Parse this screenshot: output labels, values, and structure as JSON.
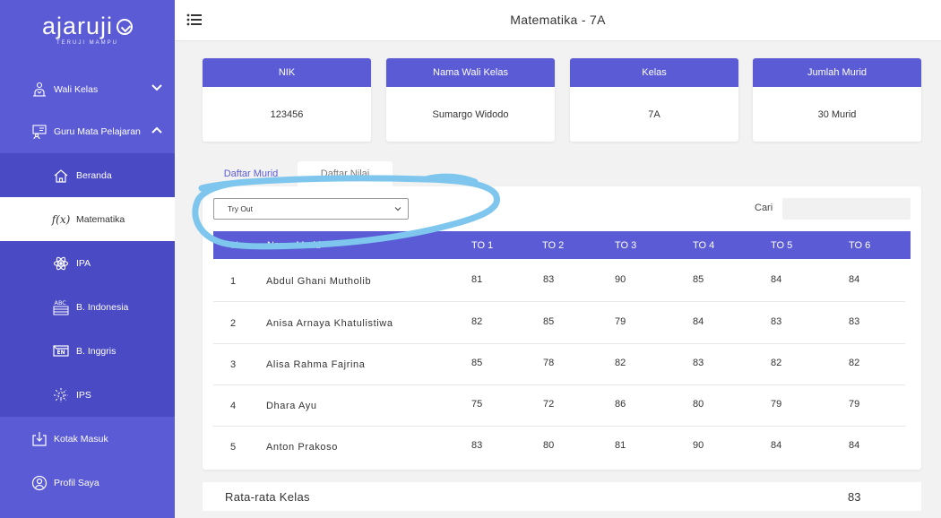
{
  "brand": {
    "name": "ajaruji",
    "tagline": "TERUJI MAMPU"
  },
  "sidebar": {
    "items": [
      {
        "label": "Wali Kelas",
        "icon": "teacher-icon",
        "expanded": false
      },
      {
        "label": "Guru Mata Pelajaran",
        "icon": "classroom-icon",
        "expanded": true
      }
    ],
    "sub_items": [
      {
        "label": "Beranda",
        "icon": "home-icon"
      },
      {
        "label": "Matematika",
        "icon": "function-icon",
        "active": true
      },
      {
        "label": "IPA",
        "icon": "atom-icon"
      },
      {
        "label": "B. Indonesia",
        "icon": "abc-book-icon"
      },
      {
        "label": "B. Inggris",
        "icon": "english-icon"
      },
      {
        "label": "IPS",
        "icon": "globe-icon"
      }
    ],
    "bottom_items": [
      {
        "label": "Kotak Masuk",
        "icon": "inbox-icon"
      },
      {
        "label": "Profil Saya",
        "icon": "user-icon"
      }
    ]
  },
  "header": {
    "title": "Matematika - 7A"
  },
  "info_cards": [
    {
      "label": "NIK",
      "value": "123456"
    },
    {
      "label": "Nama Wali Kelas",
      "value": "Sumargo Widodo"
    },
    {
      "label": "Kelas",
      "value": "7A"
    },
    {
      "label": "Jumlah Murid",
      "value": "30 Murid"
    }
  ],
  "tabs": [
    {
      "label": "Daftar Murid",
      "active": false
    },
    {
      "label": "Daftar Nilai",
      "active": true
    }
  ],
  "filter": {
    "selected": "Try Out"
  },
  "search": {
    "label": "Cari",
    "placeholder": ""
  },
  "table": {
    "columns": [
      "No",
      "Nama Murid",
      "TO 1",
      "TO 2",
      "TO 3",
      "TO 4",
      "TO 5",
      "TO 6"
    ],
    "rows": [
      [
        "1",
        "Abdul Ghani Mutholib",
        "81",
        "83",
        "90",
        "85",
        "84",
        "84"
      ],
      [
        "2",
        "Anisa Arnaya Khatulistiwa",
        "82",
        "85",
        "79",
        "84",
        "83",
        "83"
      ],
      [
        "3",
        "Alisa Rahma Fajrina",
        "85",
        "78",
        "82",
        "83",
        "82",
        "82"
      ],
      [
        "4",
        "Dhara Ayu",
        "75",
        "72",
        "86",
        "80",
        "79",
        "79"
      ],
      [
        "5",
        "Anton Prakoso",
        "83",
        "80",
        "81",
        "90",
        "84",
        "84"
      ]
    ]
  },
  "average": {
    "label": "Rata-rata Kelas",
    "value": "83"
  },
  "colors": {
    "primary": "#5b5bd6",
    "sidebar_sub": "#4a4ac4",
    "scribble": "#7ec6ee"
  }
}
